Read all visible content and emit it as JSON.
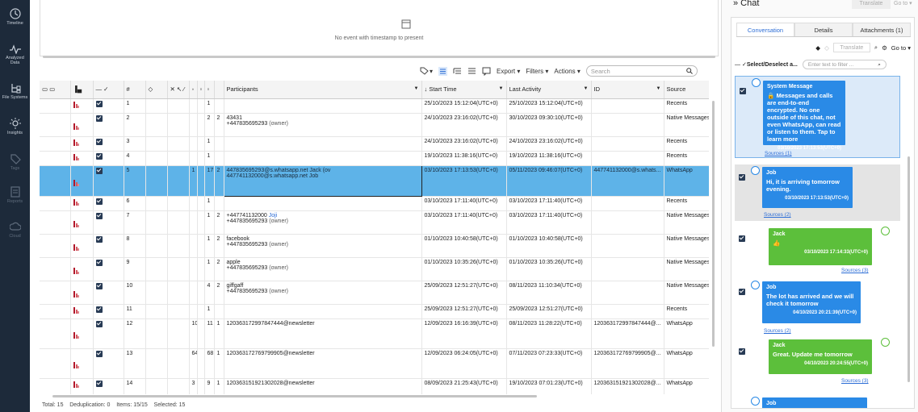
{
  "nav": {
    "items": [
      {
        "label": "Timeline"
      },
      {
        "label": "Analyzed\nData"
      },
      {
        "label": "File Systems"
      },
      {
        "label": "Insights"
      },
      {
        "label": "Tags"
      },
      {
        "label": "Reports"
      },
      {
        "label": "Cloud"
      }
    ]
  },
  "timeline": {
    "empty_text": "No event with timestamp to present"
  },
  "toolbar": {
    "export_label": "Export",
    "filters_label": "Filters",
    "actions_label": "Actions",
    "search_placeholder": "Search"
  },
  "grid": {
    "columns": {
      "num": "#",
      "participants": "Participants",
      "start_time": "Start Time",
      "last_activity": "Last Activity",
      "id": "ID",
      "source": "Source"
    },
    "rows": [
      {
        "num": "1",
        "c1": "",
        "c2": "1",
        "c3": "",
        "p1": "",
        "p2": "",
        "start": "25/10/2023 15:12:04(UTC+0)",
        "last": "25/10/2023 15:12:04(UTC+0)",
        "id": "",
        "source": "Recents"
      },
      {
        "num": "2",
        "c1": "",
        "c2": "2",
        "c3": "2",
        "p1": "43431",
        "p2": "+447835695293",
        "p2b": "(owner)",
        "start": "24/10/2023 23:16:02(UTC+0)",
        "last": "30/10/2023 09:30:10(UTC+0)",
        "id": "",
        "source": "Native Messages"
      },
      {
        "num": "3",
        "c1": "",
        "c2": "1",
        "c3": "",
        "p1": "",
        "p2": "",
        "start": "24/10/2023 23:16:02(UTC+0)",
        "last": "24/10/2023 23:16:02(UTC+0)",
        "id": "",
        "source": "Recents"
      },
      {
        "num": "4",
        "c1": "",
        "c2": "1",
        "c3": "",
        "p1": "",
        "p2": "",
        "start": "19/10/2023 11:38:16(UTC+0)",
        "last": "19/10/2023 11:38:16(UTC+0)",
        "id": "",
        "source": "Recents"
      },
      {
        "num": "5",
        "c1": "1",
        "c2": "17",
        "c3": "2",
        "p1": "447835695293@s.whatsapp.net",
        "p1b": "Jack (ov",
        "p2": "447741132000@s.whatsapp.net",
        "p2b": "Job",
        "start": "03/10/2023 17:13:53(UTC+0)",
        "last": "05/11/2023 09:46:07(UTC+0)",
        "id": "447741132000@s.whats...",
        "source": "WhatsApp"
      },
      {
        "num": "6",
        "c1": "",
        "c2": "1",
        "c3": "",
        "p1": "",
        "p2": "",
        "start": "03/10/2023 17:11:40(UTC+0)",
        "last": "03/10/2023 17:11:40(UTC+0)",
        "id": "",
        "source": "Recents"
      },
      {
        "num": "7",
        "c1": "",
        "c2": "1",
        "c3": "2",
        "p1": "+447741132000",
        "p1b": "Joji",
        "p2": "+447835695293",
        "p2b": "(owner)",
        "start": "03/10/2023 17:11:40(UTC+0)",
        "last": "03/10/2023 17:11:40(UTC+0)",
        "id": "",
        "source": "Native Messages"
      },
      {
        "num": "8",
        "c1": "",
        "c2": "1",
        "c3": "2",
        "p1": "facebook",
        "p2": "+447835695293",
        "p2b": "(owner)",
        "start": "01/10/2023 10:40:58(UTC+0)",
        "last": "01/10/2023 10:40:58(UTC+0)",
        "id": "",
        "source": "Native Messages"
      },
      {
        "num": "9",
        "c1": "",
        "c2": "1",
        "c3": "2",
        "p1": "apple",
        "p2": "+447835695293",
        "p2b": "(owner)",
        "start": "01/10/2023 10:35:26(UTC+0)",
        "last": "01/10/2023 10:35:26(UTC+0)",
        "id": "",
        "source": "Native Messages"
      },
      {
        "num": "10",
        "c1": "",
        "c2": "4",
        "c3": "2",
        "p1": "giffgaff",
        "p2": "+447835695293",
        "p2b": "(owner)",
        "start": "25/09/2023 12:51:27(UTC+0)",
        "last": "08/11/2023 11:10:34(UTC+0)",
        "id": "",
        "source": "Native Messages"
      },
      {
        "num": "11",
        "c1": "",
        "c2": "1",
        "c3": "",
        "p1": "",
        "p2": "",
        "start": "25/09/2023 12:51:27(UTC+0)",
        "last": "25/09/2023 12:51:27(UTC+0)",
        "id": "",
        "source": "Recents"
      },
      {
        "num": "12",
        "c1": "10",
        "c2": "11",
        "c3": "1",
        "p1": "120363172997847444@newsletter",
        "p2": "",
        "start": "12/09/2023 16:16:39(UTC+0)",
        "last": "08/11/2023 11:28:22(UTC+0)",
        "id": "120363172997847444@...",
        "source": "WhatsApp"
      },
      {
        "num": "13",
        "c1": "64",
        "c2": "68",
        "c3": "1",
        "p1": "120363172769799905@newsletter",
        "p2": "",
        "start": "12/09/2023 06:24:05(UTC+0)",
        "last": "07/11/2023 07:23:33(UTC+0)",
        "id": "120363172769799905@...",
        "source": "WhatsApp"
      },
      {
        "num": "14",
        "c1": "3",
        "c2": "9",
        "c3": "1",
        "p1": "120363151921302028@newsletter",
        "p2": "",
        "start": "08/09/2023 21:25:43(UTC+0)",
        "last": "19/10/2023 07:01:23(UTC+0)",
        "id": "120363151921302028@...",
        "source": "WhatsApp"
      }
    ]
  },
  "status": {
    "text": "Total: 15    Deduplication: 0    Items: 15/15    Selected: 15"
  },
  "chat": {
    "title": "» Chat",
    "translate_top": "Translate",
    "goto_top": "Go to",
    "tabs": [
      "Conversation",
      "Details",
      "Attachments (1)"
    ],
    "translate": "Translate",
    "goto": "Go to",
    "select_label": "Select/Deselect a...",
    "filter_placeholder": "Enter text to filter ...",
    "messages": [
      {
        "name": "System Message",
        "body": "Messages and calls are end-to-end encrypted. No one outside of this chat, not even WhatsApp, can read or listen to them. Tap to learn more",
        "ts": "03/10/2023 17:13:53(UTC+0)",
        "source": "Sources (1)"
      },
      {
        "name": "Job",
        "body": "Hi, it is arriving tomorrow evening.",
        "ts": "03/10/2023 17:13:53(UTC+0)",
        "source": "Sources (2)"
      },
      {
        "name": "Jack",
        "body": "👍",
        "ts": "03/10/2023 17:14:33(UTC+0)",
        "source": "Sources (3)"
      },
      {
        "name": "Job",
        "body": "The lot has arrived and we will check it tomorrow",
        "ts": "04/10/2023 20:21:39(UTC+0)",
        "source": "Sources (2)"
      },
      {
        "name": "Jack",
        "body": "Great. Update me tomorrow",
        "ts": "04/10/2023 20:24:55(UTC+0)",
        "source": "Sources (3)"
      },
      {
        "name": "Job"
      }
    ]
  },
  "colors": {
    "nav_bg": "#1d2a3a",
    "selection": "#5eb3e8",
    "bubble_blue": "#2a8ae6",
    "bubble_green": "#5cbf3b"
  }
}
